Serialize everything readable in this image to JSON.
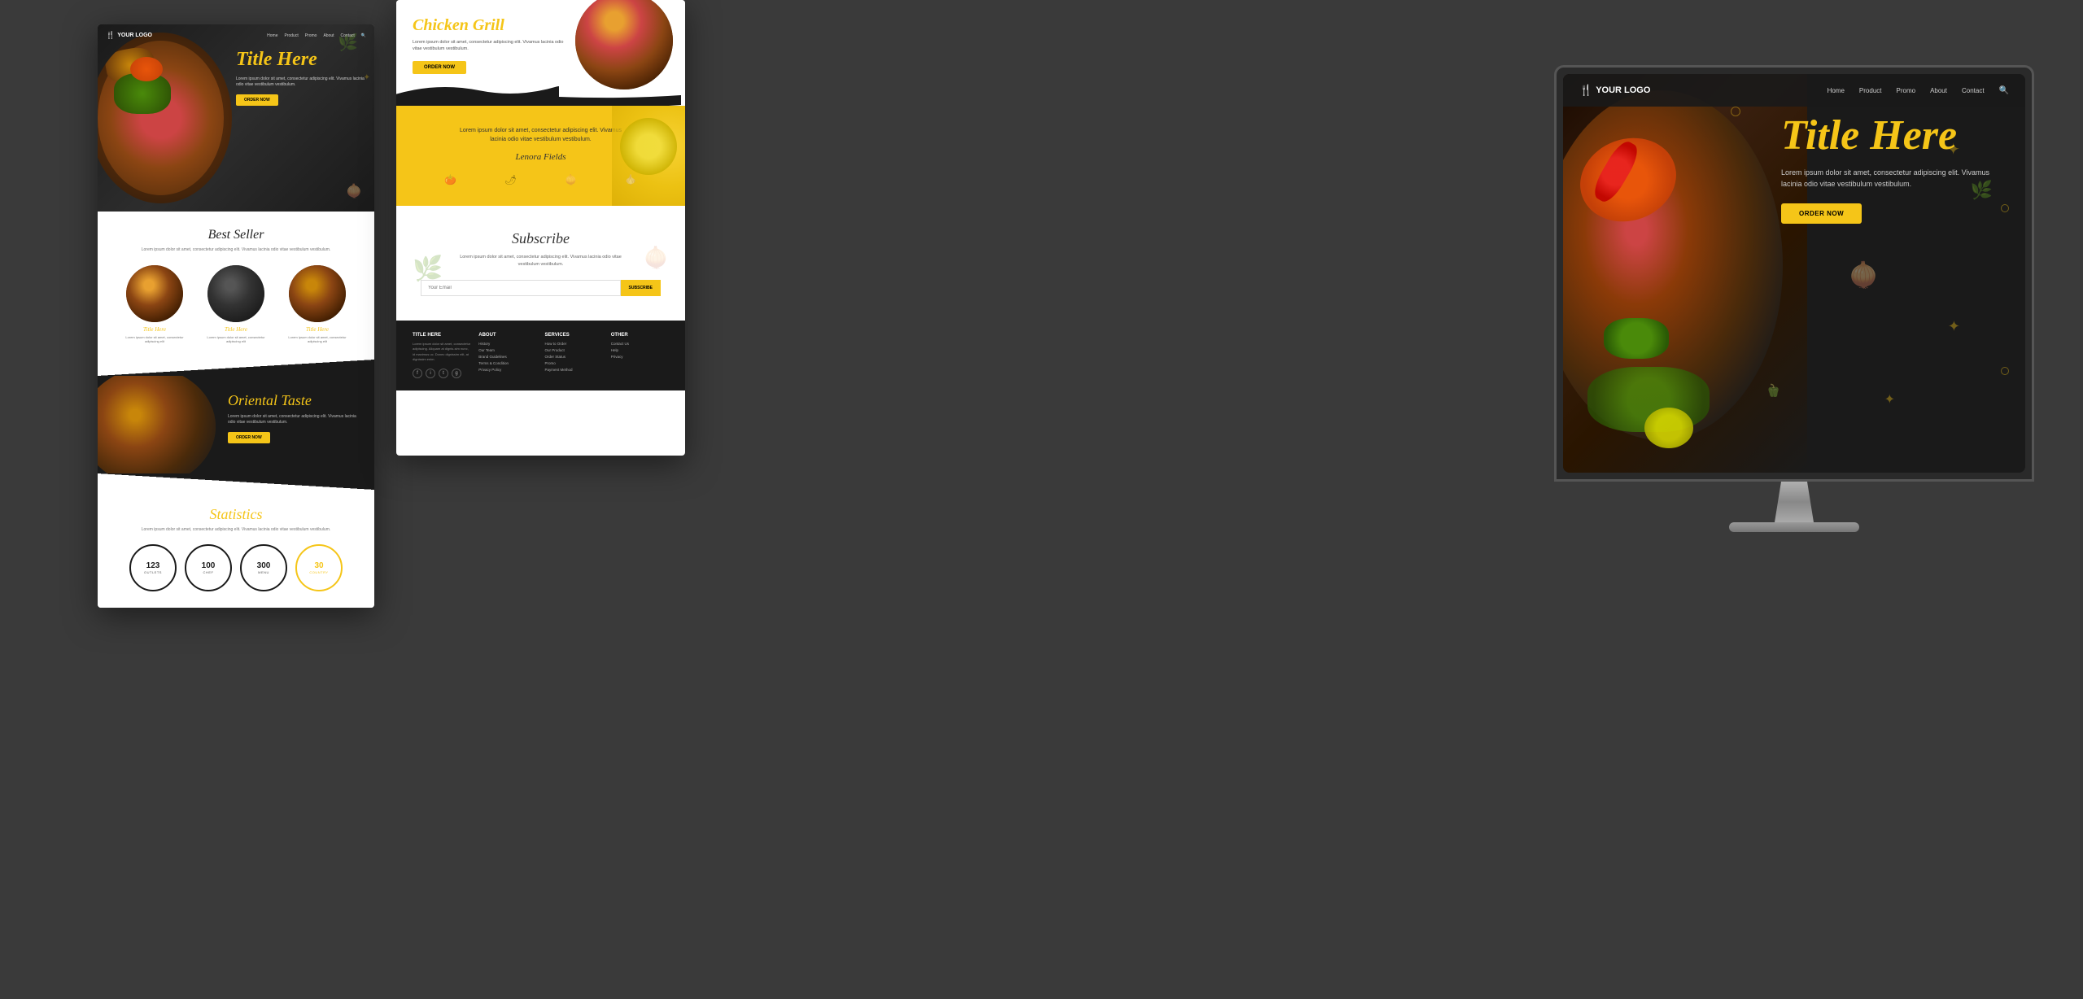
{
  "left_mockup": {
    "nav": {
      "logo": "YOUR LOGO",
      "links": [
        "Home",
        "Product",
        "Promo",
        "About",
        "Contact"
      ]
    },
    "hero": {
      "title": "Title Here",
      "text": "Lorem ipsum dolor sit amet, consectetur adipiscing elit. Vivamus lacinia odio vitae vestibulum vestibulum.",
      "button": "ORDER NOW"
    },
    "bestseller": {
      "title": "Best Seller",
      "text": "Lorem ipsum dolor sit amet, consectetur adipiscing elit. Vivamus lacinia odio vitae vestibulum vestibulum.",
      "products": [
        {
          "title": "Title Here",
          "text": "Lorem ipsum dolor sit amet, consectetur adipiscing elit"
        },
        {
          "title": "Title Here",
          "text": "Lorem ipsum dolor sit amet, consectetur adipiscing elit"
        },
        {
          "title": "Title Here",
          "text": "Lorem ipsum dolor sit amet, consectetur adipiscing elit"
        }
      ]
    },
    "oriental": {
      "title": "Oriental Taste",
      "text": "Lorem ipsum dolor sit amet, consectetur adipiscing elit. Vivamus lacinia odio vitae vestibulum vestibulum.",
      "button": "ORDER NOW"
    },
    "statistics": {
      "title": "Statistics",
      "text": "Lorem ipsum dolor sit amet, consectetur adipiscing elit. Vivamus lacinia odio vitae vestibulum vestibulum.",
      "stats": [
        {
          "number": "123",
          "label": "OUTLETS"
        },
        {
          "number": "100",
          "label": "CHEF"
        },
        {
          "number": "300",
          "label": "MENU"
        },
        {
          "number": "30",
          "label": "COUNTRY"
        }
      ]
    }
  },
  "middle_mockup": {
    "hero": {
      "title": "Chicken Grill",
      "text": "Lorem ipsum dolor sit amet, consectetur adipiscing elit. Vivamus lacinia odio vitae vestibulum vestibulum.",
      "button": "ORDER NOW"
    },
    "testimonial": {
      "text": "Lorem ipsum dolor sit amet, consectetur adipiscing elit. Vivamus lacinia odio vitae vestibulum vestibulum.",
      "author": "Lenora Fields"
    },
    "subscribe": {
      "title": "Subscribe",
      "text": "Lorem ipsum dolor sit amet, consectetur adipiscing elit. Vivamus lacinia odio vitae vestibulum vestibulum.",
      "input_placeholder": "Your Email",
      "button": "SUBSCRIBE"
    },
    "footer": {
      "columns": [
        {
          "title": "TITLE HERE",
          "text": "Lorem ipsum dolor sit amet, consectetur adipiscing. Aliquam at dignis-sim nunc, id maximus uc. Donec dignissim elit, at dignissim enim.",
          "social": [
            "f",
            "i",
            "t",
            "g"
          ]
        },
        {
          "title": "ABOUT",
          "links": [
            "History",
            "Our Team",
            "Brand Guidelines",
            "Terms & Condition",
            "Privacy Policy"
          ]
        },
        {
          "title": "SERVICES",
          "links": [
            "How to Order",
            "Our Product",
            "Order Status",
            "Promo",
            "Payment Method"
          ]
        },
        {
          "title": "OTHER",
          "links": [
            "Contact Us",
            "Help",
            "Privacy"
          ]
        }
      ]
    }
  },
  "right_monitor": {
    "nav": {
      "logo": "YOUR LOGO",
      "links": [
        "Home",
        "Product",
        "Promo",
        "About",
        "Contact"
      ]
    },
    "hero": {
      "title": "Title Here",
      "text": "Lorem ipsum dolor sit amet, consectetur adipiscing elit. Vivamus lacinia odio vitae vestibulum vestibulum.",
      "button": "ORDER NOW"
    }
  }
}
